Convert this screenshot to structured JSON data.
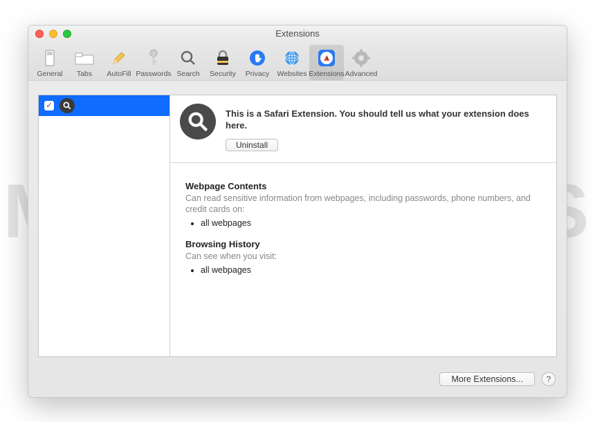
{
  "window": {
    "title": "Extensions"
  },
  "toolbar": {
    "items": [
      {
        "label": "General"
      },
      {
        "label": "Tabs"
      },
      {
        "label": "AutoFill"
      },
      {
        "label": "Passwords"
      },
      {
        "label": "Search"
      },
      {
        "label": "Security"
      },
      {
        "label": "Privacy"
      },
      {
        "label": "Websites"
      },
      {
        "label": "Extensions"
      },
      {
        "label": "Advanced"
      }
    ],
    "selected": "Extensions"
  },
  "sidebar": {
    "extension": {
      "checked": true,
      "icon": "search-icon"
    }
  },
  "detail": {
    "description": "This is a Safari Extension. You should tell us what your extension does here.",
    "uninstall_label": "Uninstall",
    "sections": [
      {
        "title": "Webpage Contents",
        "subtitle": "Can read sensitive information from webpages, including passwords, phone numbers, and credit cards on:",
        "items": [
          "all webpages"
        ]
      },
      {
        "title": "Browsing History",
        "subtitle": "Can see when you visit:",
        "items": [
          "all webpages"
        ]
      }
    ]
  },
  "footer": {
    "more_label": "More Extensions...",
    "help_label": "?"
  },
  "watermark": "MALWARETIPS"
}
